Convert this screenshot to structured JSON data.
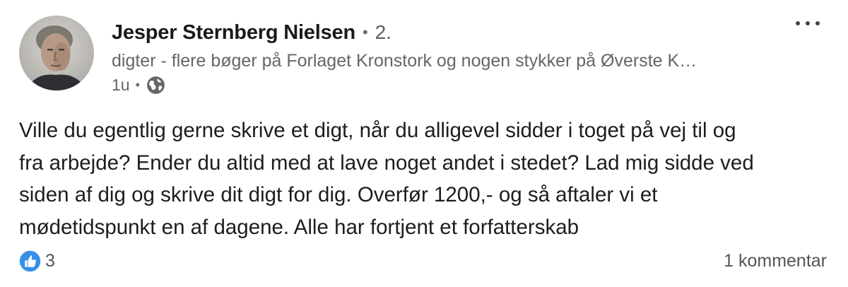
{
  "post": {
    "author": {
      "name": "Jesper Sternberg Nielsen",
      "separator": "•",
      "connection_degree": "2.",
      "headline": "digter - flere bøger på Forlaget Kronstork og nogen stykker på Øverste K…"
    },
    "meta": {
      "time": "1u",
      "separator": "•",
      "visibility_icon": "globe-icon"
    },
    "more_icon": "ellipsis-icon",
    "body_lines": [
      "Ville du egentlig gerne skrive et digt, når du alligevel sidder i toget på vej til og",
      "fra arbejde? Ender du altid med at lave noget andet i stedet? Lad mig sidde ved",
      "siden af dig og skrive dit digt for dig. Overfør 1200,- og så aftaler vi et",
      "mødetidspunkt en af dagene. Alle har fortjent et forfatterskab"
    ],
    "social": {
      "reaction_icon": "like-icon",
      "reaction_count": "3",
      "comments_label": "1 kommentar"
    },
    "colors": {
      "like_blue": "#378fe9",
      "text_primary": "#1d1d1d",
      "text_secondary": "#666666"
    }
  }
}
